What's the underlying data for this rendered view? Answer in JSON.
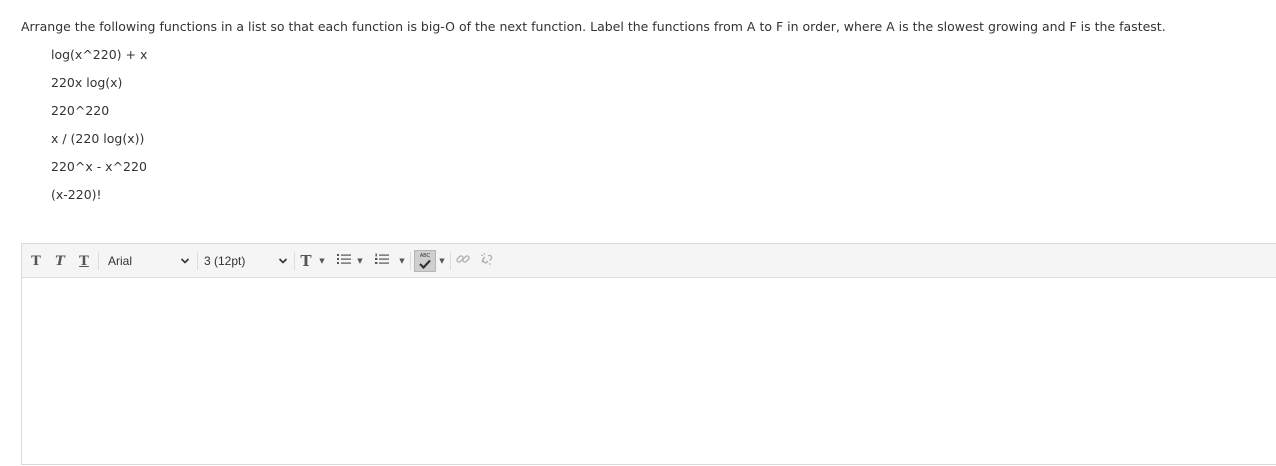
{
  "question": {
    "prompt": "Arrange the following functions in a list so that each function is big-O of the next function. Label the functions from A to F in order, where A is the slowest growing and F is the fastest.",
    "functions": [
      "log(x^220) + x",
      "220x log(x)",
      "220^220",
      "x / (220 log(x))",
      "220^x - x^220",
      "(x-220)!"
    ]
  },
  "toolbar": {
    "bold_label": "T",
    "italic_label": "T",
    "underline_label": "T",
    "font_family": "Arial",
    "font_size": "3 (12pt)",
    "text_format_label": "T",
    "spellcheck_label": "ABC",
    "icons": [
      "bold-icon",
      "italic-icon",
      "underline-icon",
      "text-format-icon",
      "bullet-list-icon",
      "numbered-list-icon",
      "spellcheck-icon",
      "link-icon",
      "unlink-icon"
    ]
  },
  "editor": {
    "content": ""
  }
}
